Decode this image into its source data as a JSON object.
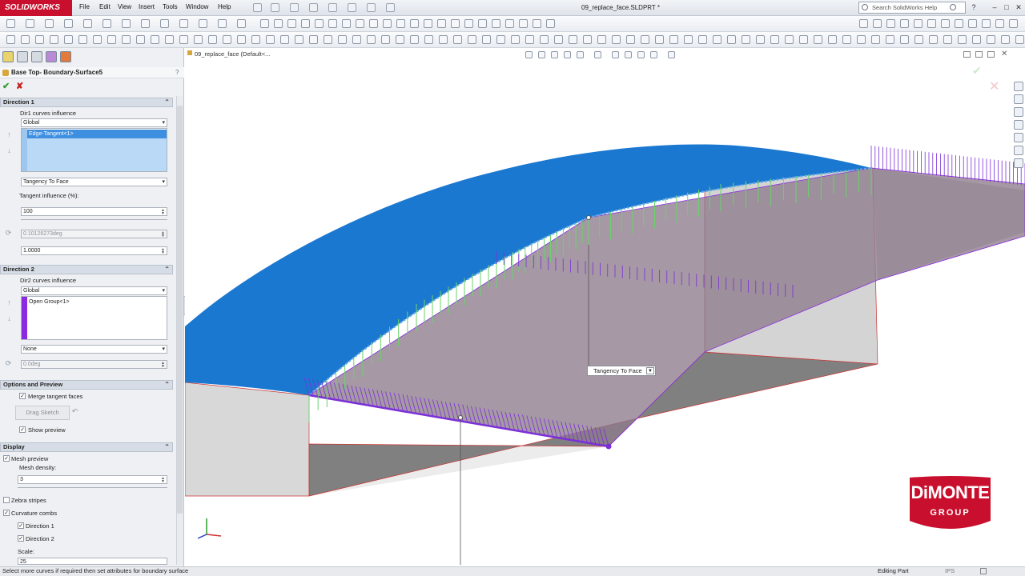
{
  "app": {
    "brand": "SOLIDWORKS",
    "brand_color": "#c8102e"
  },
  "titlebar": {
    "menus": [
      "File",
      "Edit",
      "View",
      "Insert",
      "Tools",
      "Window",
      "Help"
    ],
    "document_title": "09_replace_face.SLDPRT *",
    "search_placeholder": "Search SolidWorks Help"
  },
  "feature_manager": {
    "tab_icons": [
      "feature-manager-icon",
      "property-manager-icon",
      "configuration-manager-icon",
      "dimxpert-icon",
      "display-manager-icon"
    ],
    "title": "Base Top- Boundary-Surface5",
    "ok_icon": "checkmark-icon",
    "cancel_icon": "x-icon",
    "direction1": {
      "header": "Direction 1",
      "curves_influence_label": "Dir1 curves influence",
      "curves_influence_value": "Global",
      "list_item": "Edge-Tangent<1>",
      "tangent_type": "Tangency To Face",
      "tangent_influence_label": "Tangent influence (%):",
      "tangent_influence_value": "100",
      "angle_value": "0.10126273deg",
      "tangent_length": "1.0000"
    },
    "direction2": {
      "header": "Direction 2",
      "curves_influence_label": "Dir2 curves influence",
      "curves_influence_value": "Global",
      "list_item": "Open Group<1>",
      "tangent_type": "None",
      "angle_value": "0.0deg"
    },
    "options": {
      "header": "Options and Preview",
      "merge_label": "Merge tangent faces",
      "drag_sketch_label": "Drag Sketch",
      "show_preview_label": "Show preview"
    },
    "display": {
      "header": "Display",
      "mesh_preview_label": "Mesh preview",
      "mesh_density_label": "Mesh density:",
      "mesh_density_value": "3",
      "zebra_label": "Zebra stripes",
      "curvature_label": "Curvature combs",
      "direction1_label": "Direction 1",
      "direction2_label": "Direction 2",
      "scale_label": "Scale:",
      "scale_value": "25"
    }
  },
  "viewport": {
    "breadcrumb": "09_replace_face  (Default<...",
    "callout_label": "Tangency To Face",
    "surface_color": "#1b78d0",
    "curve_color": "#7b2fd8",
    "comb_color": "#6ad36a"
  },
  "statusbar": {
    "message": "Select more curves if required then set attributes for boundary surface",
    "mode": "Editing Part",
    "units": "IPS"
  },
  "logo": {
    "line1": "DiMONTE",
    "line2": "GROUP",
    "color": "#c8102e"
  }
}
